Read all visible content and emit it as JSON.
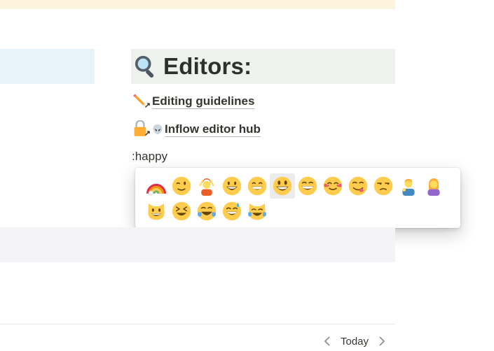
{
  "page": {
    "editors_header": {
      "title": "Editors:",
      "icon": "magnifying-glass-icon"
    },
    "links": [
      {
        "label": "Editing guidelines",
        "icon": "pencil-icon"
      },
      {
        "label": "Inflow editor hub",
        "icon": "lock-icon",
        "inline_icon": "alien-icon"
      }
    ],
    "query": ":happy"
  },
  "emoji_picker": {
    "items": [
      "rainbow",
      "winking-face",
      "person-gesturing-ok",
      "grinning-face",
      "beaming-face",
      "grinning-big-eyes",
      "grinning-squinting-eyes",
      "smiling-hearts",
      "face-savoring-food",
      "unamused-face",
      "man-tipping-hand",
      "woman-pouting",
      "grinning-cat",
      "squinting-face",
      "face-tears-of-joy",
      "grinning-sweat",
      "cat-tears-of-joy"
    ],
    "selected_index": 5
  },
  "footer": {
    "today_label": "Today"
  },
  "colors": {
    "banner": "#fbf3db",
    "callout_blue": "#e7f3f8",
    "header_green": "#edf3ec",
    "band_gray": "#f4f3f8"
  }
}
